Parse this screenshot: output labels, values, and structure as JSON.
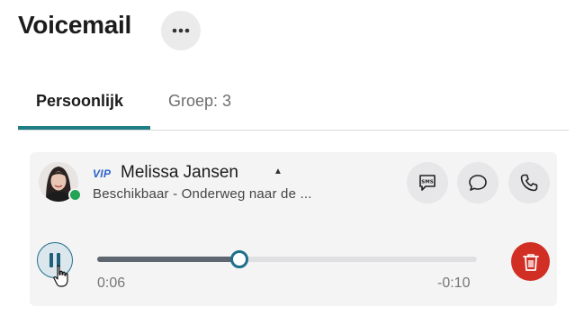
{
  "page": {
    "title": "Voicemail"
  },
  "header": {
    "more_icon": "more-horizontal-icon"
  },
  "tabs": [
    {
      "label": "Persoonlijk",
      "active": true
    },
    {
      "label": "Groep: 3",
      "active": false
    }
  ],
  "voicemail": {
    "badge": "VIP",
    "contact_name": "Melissa Jansen",
    "caret_icon": "caret-up-icon",
    "status_text": "Beschikbaar - Onderweg naar de ...",
    "status_color": "#22a356",
    "actions": [
      {
        "name": "sms",
        "icon": "sms-icon",
        "label": "SMS"
      },
      {
        "name": "chat",
        "icon": "chat-bubble-icon"
      },
      {
        "name": "call",
        "icon": "phone-icon"
      }
    ],
    "player": {
      "state_icon": "pause-icon",
      "elapsed": "0:06",
      "remaining": "-0:10",
      "progress_fraction": 0.375
    },
    "delete_icon": "trash-icon"
  },
  "colors": {
    "accent": "#1f7d86",
    "delete": "#d12e24",
    "vip": "#2d62c8"
  }
}
